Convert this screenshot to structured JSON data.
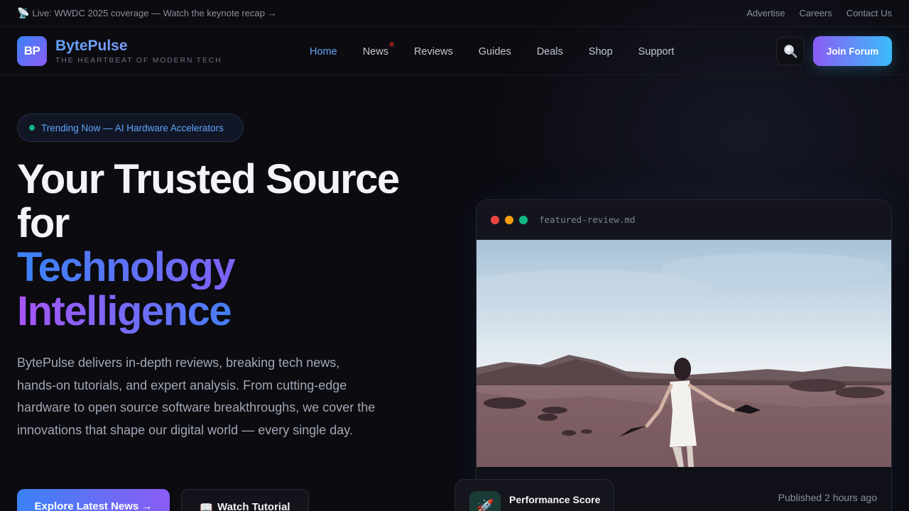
{
  "topbar": {
    "live_text": "Live: WWDC 2025 coverage — Watch the keynote recap →",
    "links": [
      "Advertise",
      "Careers",
      "Contact Us"
    ]
  },
  "header": {
    "logo_initials": "BP",
    "brand_name": "BytePulse",
    "tagline": "THE HEARTBEAT OF MODERN TECH",
    "nav": [
      "Home",
      "News",
      "Reviews",
      "Guides",
      "Deals",
      "Shop",
      "Support"
    ],
    "active_nav": "Home",
    "join_label": "Join Forum"
  },
  "hero": {
    "trending": "Trending Now — AI Hardware Accelerators",
    "title_line1": "Your Trusted Source",
    "title_line2": "for",
    "title_line3": "Technology",
    "title_line4": "Intelligence",
    "description": "BytePulse delivers in-depth reviews, breaking tech news, hands-on tutorials, and expert analysis. From cutting-edge hardware to open source software breakthroughs, we cover the innovations that shape our digital world — every single day.",
    "primary_cta": "Explore Latest News →",
    "secondary_cta": "Watch Tutorial",
    "secondary_icon": "📖"
  },
  "featured": {
    "filename": "featured-review.md",
    "published": "Published 2 hours ago",
    "score_title": "Performance Score",
    "score_icon": "🚀"
  },
  "colors": {
    "accent_blue": "#3b82f6",
    "accent_purple": "#8b5cf6",
    "accent_cyan": "#06b6d4",
    "window_red": "#ef4444",
    "window_yellow": "#f59e0b",
    "window_green": "#10b981"
  }
}
